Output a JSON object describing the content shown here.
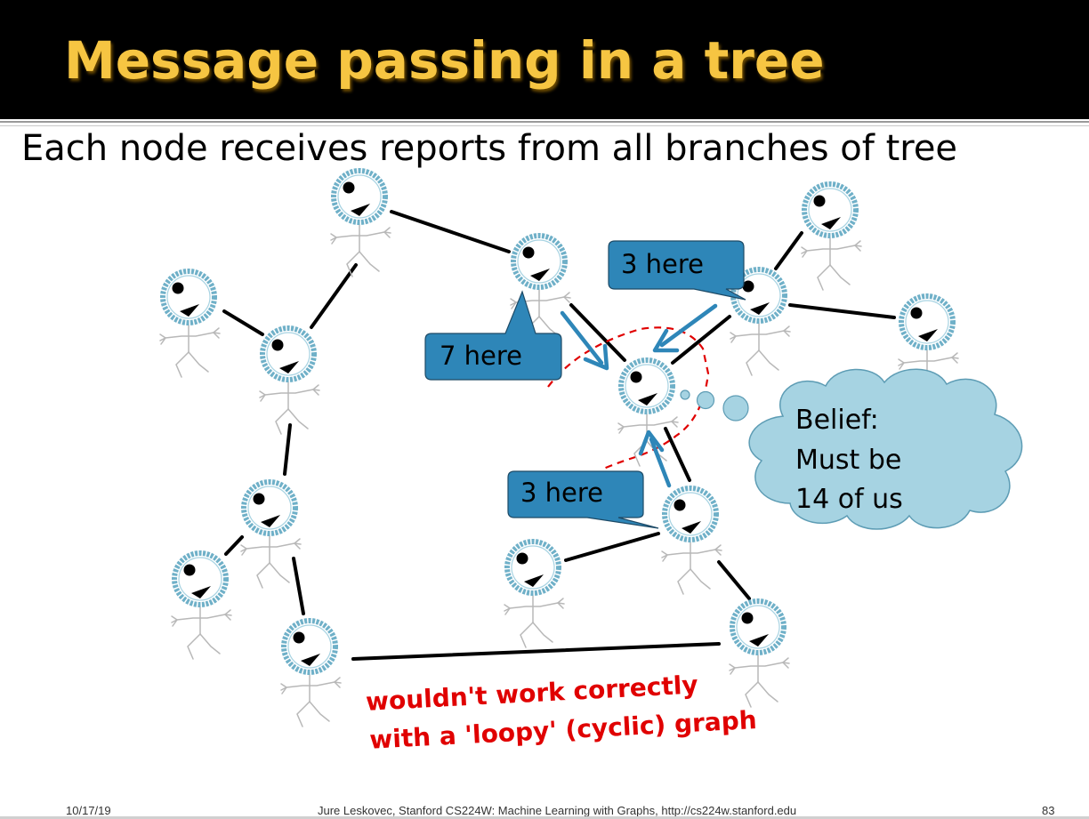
{
  "title": "Message passing in a tree",
  "subtitle": "Each node receives reports from all branches of tree",
  "callouts": {
    "seven": "7 here",
    "three_top": "3 here",
    "three_bottom": "3 here"
  },
  "belief": {
    "line1": "Belief:",
    "line2": "Must be",
    "line3": "14 of us"
  },
  "loopy_note": {
    "line1": "wouldn't work correctly",
    "line2": "with a 'loopy' (cyclic) graph"
  },
  "footer": {
    "date": "10/17/19",
    "center": "Jure Leskovec, Stanford CS224W: Machine Learning with Graphs, http://cs224w.stanford.edu",
    "page": "83"
  },
  "colors": {
    "title": "#F6C542",
    "callout_fill": "#2E86B8",
    "arrow": "#2E86B8",
    "cloud_fill": "#A6D3E2",
    "loopy_text": "#E00000",
    "dashed_boundary": "#E00000",
    "node_ring": "#6FB0C8"
  }
}
